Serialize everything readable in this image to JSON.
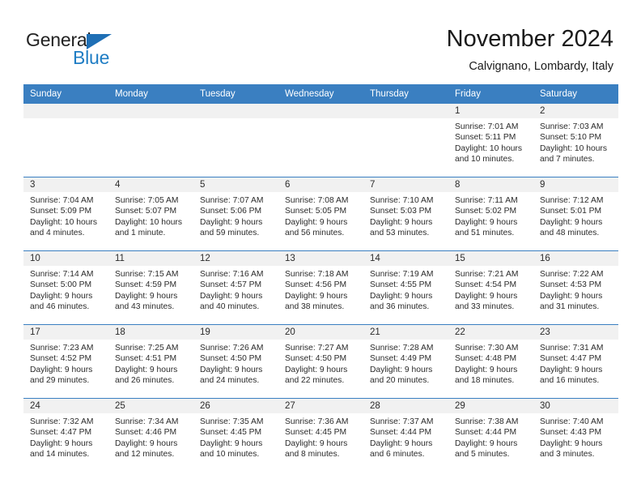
{
  "brand": {
    "name_part1": "General",
    "name_part2": "Blue",
    "triangle_icon": "blue-triangle-logo-mark",
    "color_primary": "#1f7dc4",
    "color_text": "#222222"
  },
  "header": {
    "title": "November 2024",
    "subtitle": "Calvignano, Lombardy, Italy"
  },
  "calendar": {
    "header_bg": "#3a7fc1",
    "header_text_color": "#ffffff",
    "date_band_bg": "#f1f1f1",
    "weekday_headers": [
      "Sunday",
      "Monday",
      "Tuesday",
      "Wednesday",
      "Thursday",
      "Friday",
      "Saturday"
    ],
    "weeks": [
      [
        {
          "date": "",
          "sunrise": "",
          "sunset": "",
          "daylight_line1": "",
          "daylight_line2": ""
        },
        {
          "date": "",
          "sunrise": "",
          "sunset": "",
          "daylight_line1": "",
          "daylight_line2": ""
        },
        {
          "date": "",
          "sunrise": "",
          "sunset": "",
          "daylight_line1": "",
          "daylight_line2": ""
        },
        {
          "date": "",
          "sunrise": "",
          "sunset": "",
          "daylight_line1": "",
          "daylight_line2": ""
        },
        {
          "date": "",
          "sunrise": "",
          "sunset": "",
          "daylight_line1": "",
          "daylight_line2": ""
        },
        {
          "date": "1",
          "sunrise": "Sunrise: 7:01 AM",
          "sunset": "Sunset: 5:11 PM",
          "daylight_line1": "Daylight: 10 hours",
          "daylight_line2": "and 10 minutes."
        },
        {
          "date": "2",
          "sunrise": "Sunrise: 7:03 AM",
          "sunset": "Sunset: 5:10 PM",
          "daylight_line1": "Daylight: 10 hours",
          "daylight_line2": "and 7 minutes."
        }
      ],
      [
        {
          "date": "3",
          "sunrise": "Sunrise: 7:04 AM",
          "sunset": "Sunset: 5:09 PM",
          "daylight_line1": "Daylight: 10 hours",
          "daylight_line2": "and 4 minutes."
        },
        {
          "date": "4",
          "sunrise": "Sunrise: 7:05 AM",
          "sunset": "Sunset: 5:07 PM",
          "daylight_line1": "Daylight: 10 hours",
          "daylight_line2": "and 1 minute."
        },
        {
          "date": "5",
          "sunrise": "Sunrise: 7:07 AM",
          "sunset": "Sunset: 5:06 PM",
          "daylight_line1": "Daylight: 9 hours",
          "daylight_line2": "and 59 minutes."
        },
        {
          "date": "6",
          "sunrise": "Sunrise: 7:08 AM",
          "sunset": "Sunset: 5:05 PM",
          "daylight_line1": "Daylight: 9 hours",
          "daylight_line2": "and 56 minutes."
        },
        {
          "date": "7",
          "sunrise": "Sunrise: 7:10 AM",
          "sunset": "Sunset: 5:03 PM",
          "daylight_line1": "Daylight: 9 hours",
          "daylight_line2": "and 53 minutes."
        },
        {
          "date": "8",
          "sunrise": "Sunrise: 7:11 AM",
          "sunset": "Sunset: 5:02 PM",
          "daylight_line1": "Daylight: 9 hours",
          "daylight_line2": "and 51 minutes."
        },
        {
          "date": "9",
          "sunrise": "Sunrise: 7:12 AM",
          "sunset": "Sunset: 5:01 PM",
          "daylight_line1": "Daylight: 9 hours",
          "daylight_line2": "and 48 minutes."
        }
      ],
      [
        {
          "date": "10",
          "sunrise": "Sunrise: 7:14 AM",
          "sunset": "Sunset: 5:00 PM",
          "daylight_line1": "Daylight: 9 hours",
          "daylight_line2": "and 46 minutes."
        },
        {
          "date": "11",
          "sunrise": "Sunrise: 7:15 AM",
          "sunset": "Sunset: 4:59 PM",
          "daylight_line1": "Daylight: 9 hours",
          "daylight_line2": "and 43 minutes."
        },
        {
          "date": "12",
          "sunrise": "Sunrise: 7:16 AM",
          "sunset": "Sunset: 4:57 PM",
          "daylight_line1": "Daylight: 9 hours",
          "daylight_line2": "and 40 minutes."
        },
        {
          "date": "13",
          "sunrise": "Sunrise: 7:18 AM",
          "sunset": "Sunset: 4:56 PM",
          "daylight_line1": "Daylight: 9 hours",
          "daylight_line2": "and 38 minutes."
        },
        {
          "date": "14",
          "sunrise": "Sunrise: 7:19 AM",
          "sunset": "Sunset: 4:55 PM",
          "daylight_line1": "Daylight: 9 hours",
          "daylight_line2": "and 36 minutes."
        },
        {
          "date": "15",
          "sunrise": "Sunrise: 7:21 AM",
          "sunset": "Sunset: 4:54 PM",
          "daylight_line1": "Daylight: 9 hours",
          "daylight_line2": "and 33 minutes."
        },
        {
          "date": "16",
          "sunrise": "Sunrise: 7:22 AM",
          "sunset": "Sunset: 4:53 PM",
          "daylight_line1": "Daylight: 9 hours",
          "daylight_line2": "and 31 minutes."
        }
      ],
      [
        {
          "date": "17",
          "sunrise": "Sunrise: 7:23 AM",
          "sunset": "Sunset: 4:52 PM",
          "daylight_line1": "Daylight: 9 hours",
          "daylight_line2": "and 29 minutes."
        },
        {
          "date": "18",
          "sunrise": "Sunrise: 7:25 AM",
          "sunset": "Sunset: 4:51 PM",
          "daylight_line1": "Daylight: 9 hours",
          "daylight_line2": "and 26 minutes."
        },
        {
          "date": "19",
          "sunrise": "Sunrise: 7:26 AM",
          "sunset": "Sunset: 4:50 PM",
          "daylight_line1": "Daylight: 9 hours",
          "daylight_line2": "and 24 minutes."
        },
        {
          "date": "20",
          "sunrise": "Sunrise: 7:27 AM",
          "sunset": "Sunset: 4:50 PM",
          "daylight_line1": "Daylight: 9 hours",
          "daylight_line2": "and 22 minutes."
        },
        {
          "date": "21",
          "sunrise": "Sunrise: 7:28 AM",
          "sunset": "Sunset: 4:49 PM",
          "daylight_line1": "Daylight: 9 hours",
          "daylight_line2": "and 20 minutes."
        },
        {
          "date": "22",
          "sunrise": "Sunrise: 7:30 AM",
          "sunset": "Sunset: 4:48 PM",
          "daylight_line1": "Daylight: 9 hours",
          "daylight_line2": "and 18 minutes."
        },
        {
          "date": "23",
          "sunrise": "Sunrise: 7:31 AM",
          "sunset": "Sunset: 4:47 PM",
          "daylight_line1": "Daylight: 9 hours",
          "daylight_line2": "and 16 minutes."
        }
      ],
      [
        {
          "date": "24",
          "sunrise": "Sunrise: 7:32 AM",
          "sunset": "Sunset: 4:47 PM",
          "daylight_line1": "Daylight: 9 hours",
          "daylight_line2": "and 14 minutes."
        },
        {
          "date": "25",
          "sunrise": "Sunrise: 7:34 AM",
          "sunset": "Sunset: 4:46 PM",
          "daylight_line1": "Daylight: 9 hours",
          "daylight_line2": "and 12 minutes."
        },
        {
          "date": "26",
          "sunrise": "Sunrise: 7:35 AM",
          "sunset": "Sunset: 4:45 PM",
          "daylight_line1": "Daylight: 9 hours",
          "daylight_line2": "and 10 minutes."
        },
        {
          "date": "27",
          "sunrise": "Sunrise: 7:36 AM",
          "sunset": "Sunset: 4:45 PM",
          "daylight_line1": "Daylight: 9 hours",
          "daylight_line2": "and 8 minutes."
        },
        {
          "date": "28",
          "sunrise": "Sunrise: 7:37 AM",
          "sunset": "Sunset: 4:44 PM",
          "daylight_line1": "Daylight: 9 hours",
          "daylight_line2": "and 6 minutes."
        },
        {
          "date": "29",
          "sunrise": "Sunrise: 7:38 AM",
          "sunset": "Sunset: 4:44 PM",
          "daylight_line1": "Daylight: 9 hours",
          "daylight_line2": "and 5 minutes."
        },
        {
          "date": "30",
          "sunrise": "Sunrise: 7:40 AM",
          "sunset": "Sunset: 4:43 PM",
          "daylight_line1": "Daylight: 9 hours",
          "daylight_line2": "and 3 minutes."
        }
      ]
    ]
  }
}
